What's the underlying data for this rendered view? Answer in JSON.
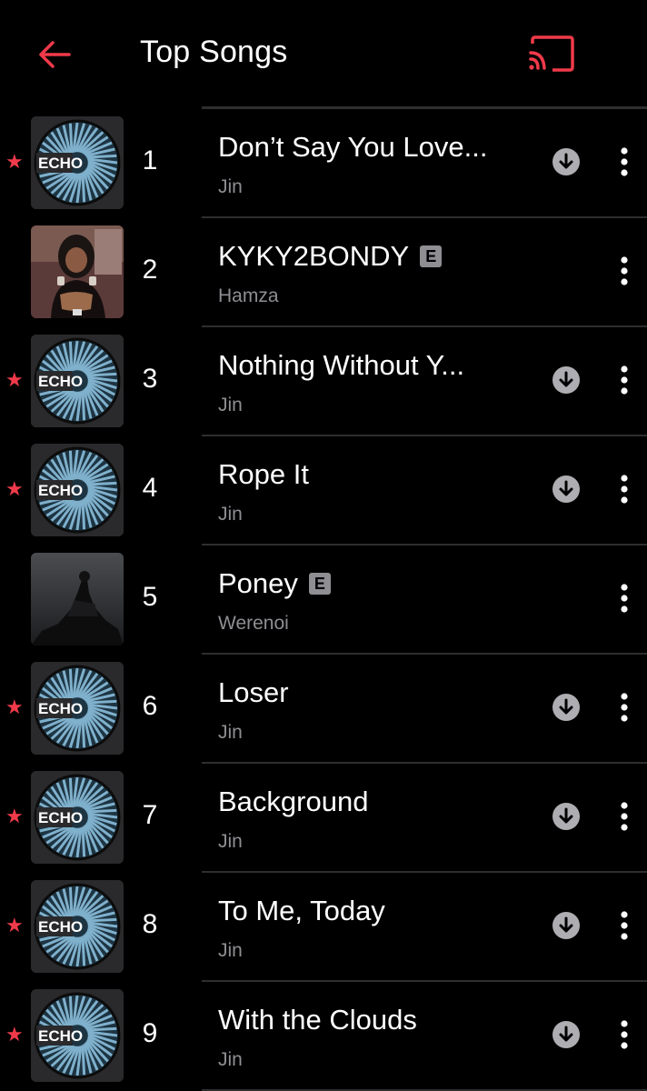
{
  "header": {
    "title": "Top Songs",
    "back_icon": "back-arrow-icon",
    "cast_icon": "cast-icon"
  },
  "colors": {
    "accent": "#f03a4a",
    "background": "#000000",
    "secondary_text": "#8e8e93",
    "divider": "#2e2e30"
  },
  "songs": [
    {
      "rank": "1",
      "title": "Don’t Say You Love...",
      "artist": "Jin",
      "favorite": true,
      "explicit": false,
      "downloaded": true,
      "art": "echo"
    },
    {
      "rank": "2",
      "title": "KYKY2BONDY",
      "artist": "Hamza",
      "favorite": false,
      "explicit": true,
      "explicit_label": "E",
      "downloaded": false,
      "art": "photo-woman"
    },
    {
      "rank": "3",
      "title": "Nothing Without Y...",
      "artist": "Jin",
      "favorite": true,
      "explicit": false,
      "downloaded": true,
      "art": "echo"
    },
    {
      "rank": "4",
      "title": "Rope It",
      "artist": "Jin",
      "favorite": true,
      "explicit": false,
      "downloaded": true,
      "art": "echo"
    },
    {
      "rank": "5",
      "title": "Poney",
      "artist": "Werenoi",
      "favorite": false,
      "explicit": true,
      "explicit_label": "E",
      "downloaded": false,
      "art": "photo-statue"
    },
    {
      "rank": "6",
      "title": "Loser",
      "artist": "Jin",
      "favorite": true,
      "explicit": false,
      "downloaded": true,
      "art": "echo"
    },
    {
      "rank": "7",
      "title": "Background",
      "artist": "Jin",
      "favorite": true,
      "explicit": false,
      "downloaded": true,
      "art": "echo"
    },
    {
      "rank": "8",
      "title": "To Me, Today",
      "artist": "Jin",
      "favorite": true,
      "explicit": false,
      "downloaded": true,
      "art": "echo"
    },
    {
      "rank": "9",
      "title": "With the Clouds",
      "artist": "Jin",
      "favorite": true,
      "explicit": false,
      "downloaded": true,
      "art": "echo"
    }
  ],
  "art_labels": {
    "echo": "ECHO"
  },
  "icons": {
    "favorite": "star-icon",
    "download": "download-icon",
    "more": "more-vertical-icon"
  }
}
